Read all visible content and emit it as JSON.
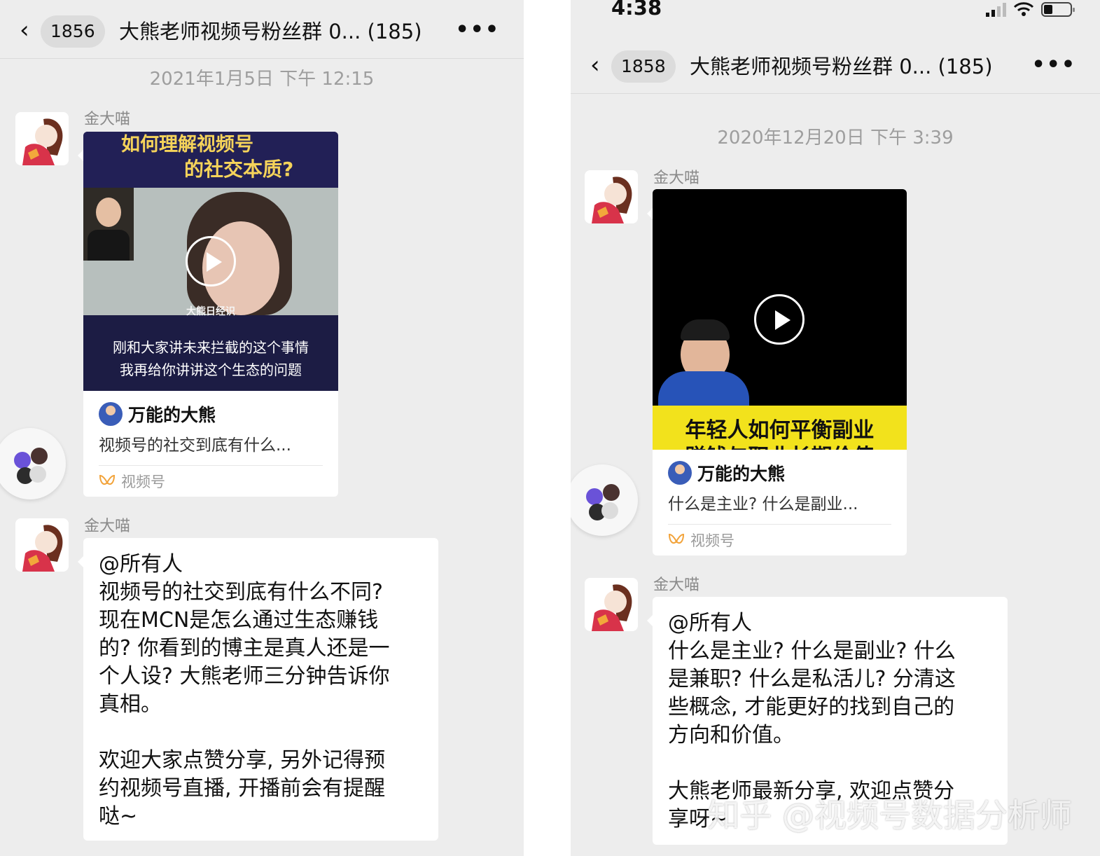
{
  "left": {
    "nav": {
      "back": "‹",
      "badge": "1856",
      "title": "大熊老师视频号粉丝群 0...  (185)",
      "more": "•••"
    },
    "timestamp": "2021年1月5日 下午 12:15",
    "msg1": {
      "sender": "金大喵",
      "video": {
        "headline_1": "如何理解视频号",
        "headline_2": "的社交本质?",
        "logo": "大熊日经识",
        "caption_1": "刚和大家讲未来拦截的这个事情",
        "caption_2": "我再给你讲讲这个生态的问题"
      },
      "author": "万能的大熊",
      "desc": "视频号的社交到底有什么...",
      "source": "视频号"
    },
    "msg2": {
      "sender": "金大喵",
      "text_1": "@所有人\n视频号的社交到底有什么不同?\n现在MCN是怎么通过生态赚钱\n的? 你看到的博主是真人还是一\n个人设? 大熊老师三分钟告诉你\n真相。",
      "text_2": "欢迎大家点赞分享, 另外记得预\n约视频号直播, 开播前会有提醒\n哒~"
    }
  },
  "right": {
    "status": {
      "time": "4:38"
    },
    "nav": {
      "back": "‹",
      "badge": "1858",
      "title": "大熊老师视频号粉丝群 0...  (185)",
      "more": "•••"
    },
    "timestamp": "2020年12月20日 下午 3:39",
    "msg1": {
      "sender": "金大喵",
      "video": {
        "banner_1": "年轻人如何平衡副业",
        "banner_2": "赚钱与职业长期价值"
      },
      "author": "万能的大熊",
      "desc": "什么是主业? 什么是副业...",
      "source": "视频号"
    },
    "msg2": {
      "sender": "金大喵",
      "text_1": "@所有人\n什么是主业? 什么是副业? 什么\n是兼职? 什么是私活儿? 分清这\n些概念, 才能更好的找到自己的\n方向和价值。",
      "text_2": "大熊老师最新分享, 欢迎点赞分\n享呀~"
    }
  },
  "watermark": "知乎 @视频号数据分析师",
  "colors": {
    "chat_bg": "#ededed",
    "bubble": "#ffffff",
    "banner_yellow": "#f2e21c",
    "video_dark": "#1a1a3a"
  }
}
